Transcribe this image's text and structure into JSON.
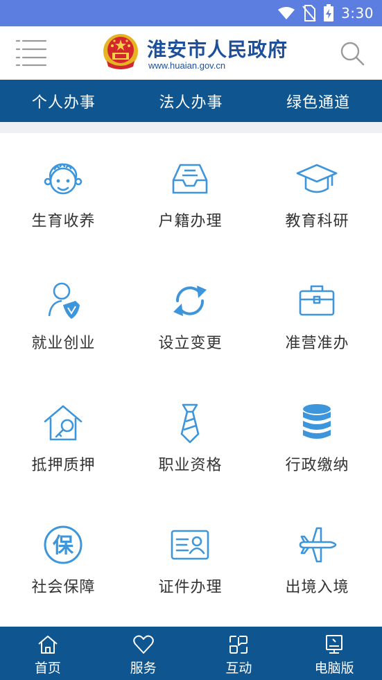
{
  "status_bar": {
    "time": "3:30"
  },
  "header": {
    "site_title": "淮安市人民政府",
    "site_url": "www.huaian.gov.cn"
  },
  "nav_tabs": [
    {
      "label": "个人办事"
    },
    {
      "label": "法人办事"
    },
    {
      "label": "绿色通道"
    }
  ],
  "services": [
    {
      "label": "生育收养",
      "icon": "baby-icon"
    },
    {
      "label": "户籍办理",
      "icon": "inbox-tray-icon"
    },
    {
      "label": "教育科研",
      "icon": "graduation-cap-icon"
    },
    {
      "label": "就业创业",
      "icon": "person-shield-icon"
    },
    {
      "label": "设立变更",
      "icon": "refresh-icon"
    },
    {
      "label": "准营准办",
      "icon": "toolbox-icon"
    },
    {
      "label": "抵押质押",
      "icon": "house-key-icon"
    },
    {
      "label": "职业资格",
      "icon": "necktie-icon"
    },
    {
      "label": "行政缴纳",
      "icon": "coin-stack-icon"
    },
    {
      "label": "社会保障",
      "icon": "bao-circle-icon"
    },
    {
      "label": "证件办理",
      "icon": "id-card-icon"
    },
    {
      "label": "出境入境",
      "icon": "airplane-icon"
    }
  ],
  "bottom_tabs": [
    {
      "label": "首页",
      "icon": "home-icon"
    },
    {
      "label": "服务",
      "icon": "heart-icon"
    },
    {
      "label": "互动",
      "icon": "interaction-icon"
    },
    {
      "label": "电脑版",
      "icon": "desktop-icon"
    }
  ],
  "colors": {
    "status_bar": "#5b7ee0",
    "nav_bar": "#0f5590",
    "icon_blue": "#3d95db",
    "title_blue": "#1d4f9a"
  }
}
